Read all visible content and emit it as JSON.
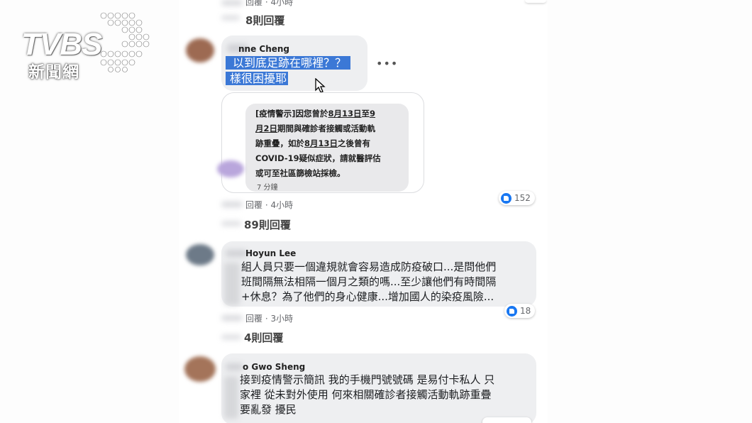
{
  "logo": {
    "brand": "TVBS",
    "subtitle": "新聞網"
  },
  "comments": [
    {
      "meta_label": "回覆",
      "meta_time": "4小時",
      "replies": "8則回覆"
    },
    {
      "name": "nne Cheng",
      "line1": "以到底足跡在哪裡？？",
      "line2": "樣很困擾耶",
      "sms": {
        "text_pre": "[疫情警示]因您曾於",
        "d1": "8月13日",
        "mid1": "至",
        "d2a": "9",
        "d2b": "月2日",
        "line2_rest": "期間與確診者接觸或活動軌",
        "line3_pre": "跡重疊，如於",
        "d3": "8月13日",
        "line3_rest": "之後曾有",
        "line4": "COVID-19疑似症狀，請就醫評估",
        "line5": "或可至社區篩檢站採檢。",
        "time": "7 分鐘"
      },
      "reactions": "152",
      "meta_label": "回覆",
      "meta_time": "4小時",
      "replies": "89則回覆"
    },
    {
      "name": "Hoyun Lee",
      "line1": "組人員只要一個違規就會容易造成防疫破口...是問他們",
      "line2": "班間隔無法相隔一個月之類的嗎...至少讓他們有時間隔",
      "line3": "+休息？為了他們的身心健康...增加國人的染疫風險...",
      "reactions": "18",
      "meta_label": "回覆",
      "meta_time": "3小時",
      "replies": "4則回覆"
    },
    {
      "name": "o Gwo Sheng",
      "line1": "接到疫情警示簡訊 我的手機門號號碼 是易付卡私人 只",
      "line2": "家裡 從未對外使用 何來相關確診者接觸活動軌跡重疊",
      "line3": "要亂發 擾民"
    }
  ]
}
